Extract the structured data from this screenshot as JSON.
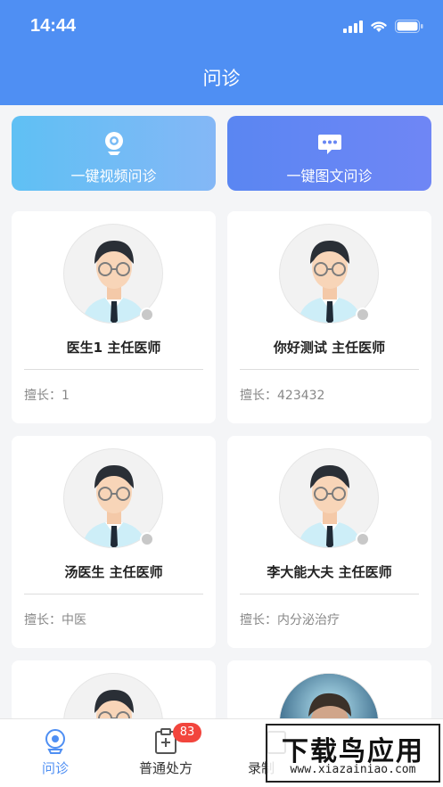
{
  "status": {
    "time": "14:44"
  },
  "header": {
    "title": "问诊"
  },
  "quick_actions": {
    "video_label": "一键视频问诊",
    "text_label": "一键图文问诊"
  },
  "doctors": [
    {
      "name": "医生1  主任医师",
      "specialty": "擅长：1"
    },
    {
      "name": "你好测试  主任医师",
      "specialty": "擅长：423432"
    },
    {
      "name": "汤医生  主任医师",
      "specialty": "擅长：中医"
    },
    {
      "name": "李大能大夫  主任医师",
      "specialty": "擅长：内分泌治疗"
    }
  ],
  "tabbar": {
    "tabs": [
      {
        "label": "问诊",
        "icon": "camera-icon",
        "active": true
      },
      {
        "label": "普通处方",
        "icon": "prescription-icon",
        "badge": "83"
      },
      {
        "label": "录制",
        "icon": "record-icon"
      }
    ]
  },
  "watermark": {
    "title": "下载鸟应用",
    "url": "www.xiazainiao.com"
  },
  "colors": {
    "primary": "#4f8ff3",
    "badge": "#f2453d"
  }
}
